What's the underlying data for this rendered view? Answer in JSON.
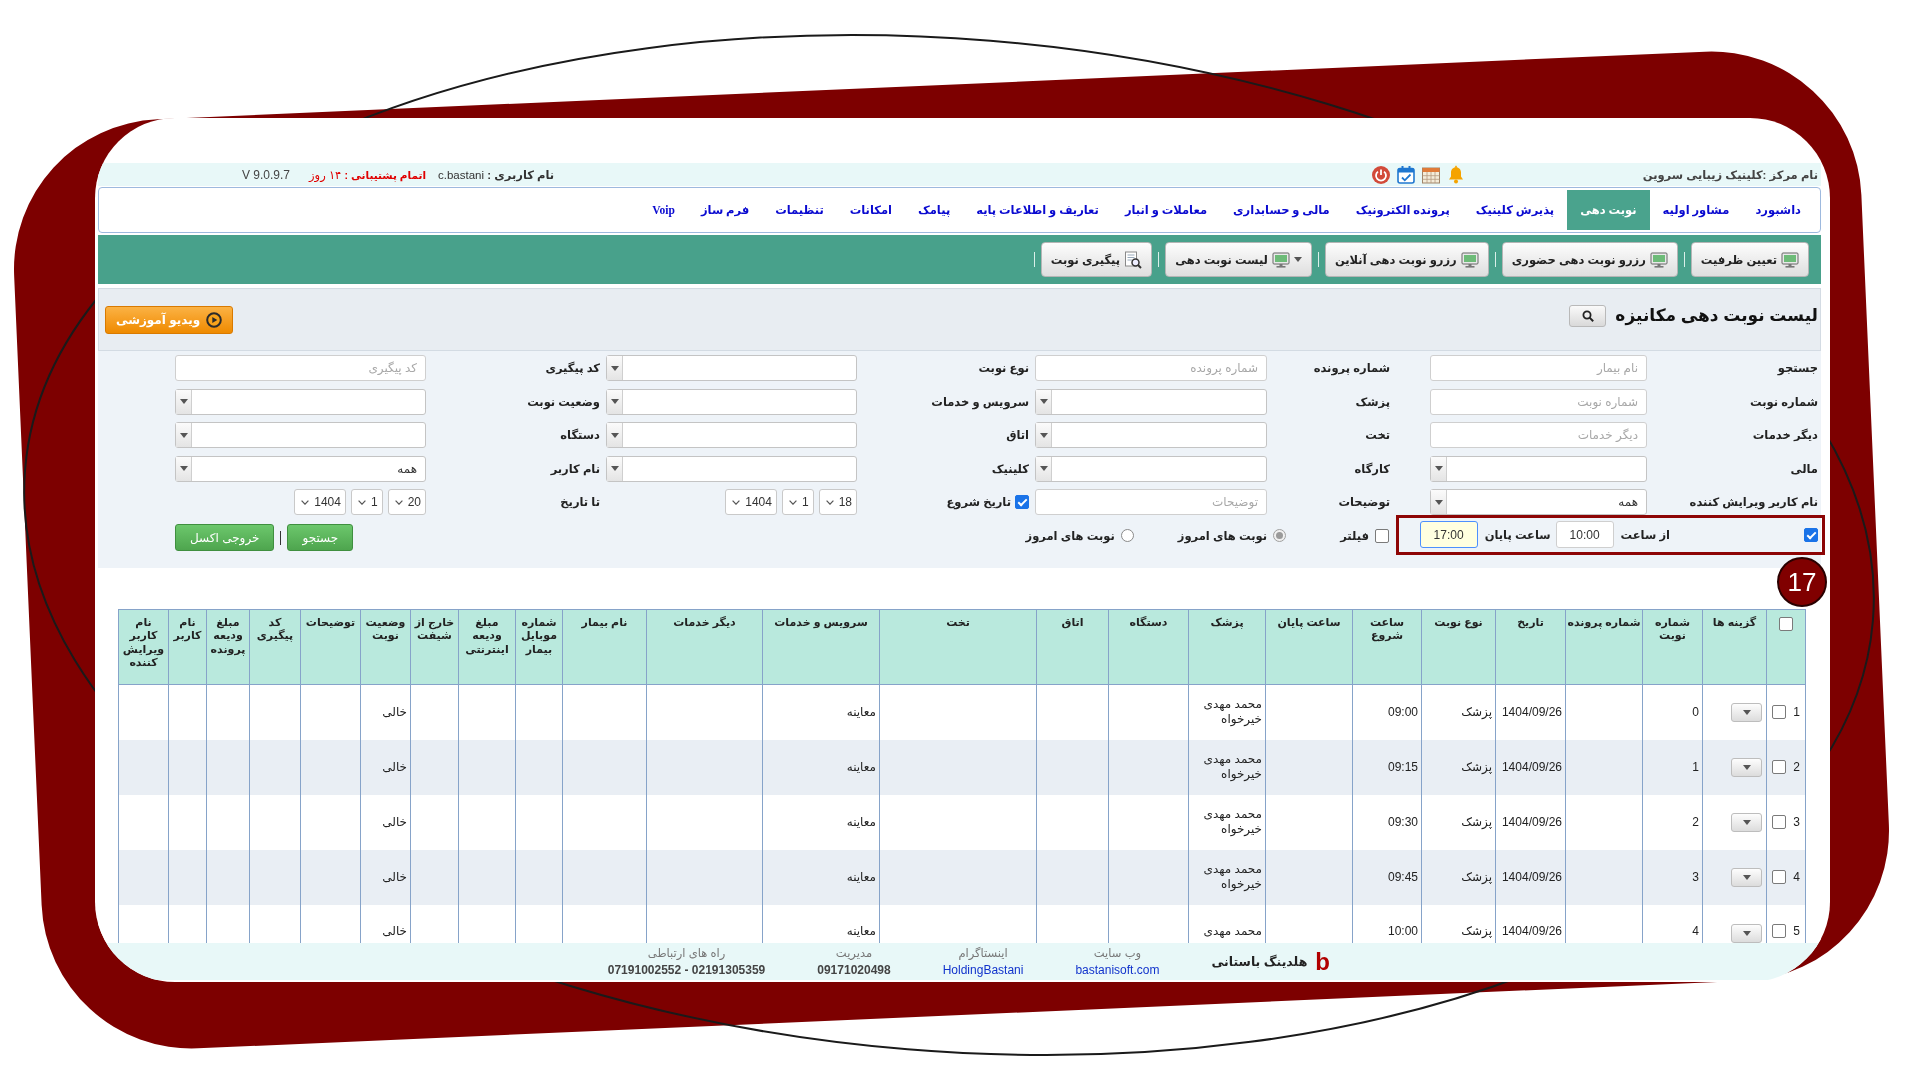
{
  "header": {
    "center_name": "نام مرکز :کلینیک زیبایی سروین",
    "user": "**نام کاربری :** c.bastani",
    "support": "**اتمام پشتیبانی :** ۱۴ روز",
    "version": "V 9.0.9.7"
  },
  "nav": [
    {
      "label": "داشبورد",
      "selected": false
    },
    {
      "label": "مشاور اولیه",
      "selected": false
    },
    {
      "label": "نوبت دهی",
      "selected": true
    },
    {
      "label": "پذیرش کلینیک",
      "selected": false
    },
    {
      "label": "پرونده الکترونیک",
      "selected": false
    },
    {
      "label": "مالی و حسابداری",
      "selected": false
    },
    {
      "label": "معاملات و انبار",
      "selected": false
    },
    {
      "label": "تعاریف و اطلاعات پایه",
      "selected": false
    },
    {
      "label": "پیامک",
      "selected": false
    },
    {
      "label": "امکانات",
      "selected": false
    },
    {
      "label": "تنظیمات",
      "selected": false
    },
    {
      "label": "فرم ساز",
      "selected": false
    },
    {
      "label": "Voip",
      "selected": false
    }
  ],
  "toolbar": [
    {
      "label": "تعیین ظرفیت",
      "kind": "action"
    },
    {
      "label": "رزرو نوبت دهی حضوری",
      "kind": "action"
    },
    {
      "label": "رزرو نوبت دهی آنلاین",
      "kind": "action"
    },
    {
      "label": "لیست نوبت دهی",
      "kind": "menu"
    },
    {
      "label": "پیگیری نوبت",
      "kind": "search"
    }
  ],
  "page": {
    "title": "لیست نوبت دهی مکانیزه",
    "video_button": "ویدیو آموزشی"
  },
  "filters": {
    "rows": [
      [
        {
          "label": "جستجو",
          "field": {
            "kind": "input",
            "placeholder": "نام بیمار"
          }
        },
        {
          "label": "شماره پرونده",
          "field": {
            "kind": "input",
            "placeholder": "شماره پرونده"
          }
        },
        {
          "label": "نوع نوبت",
          "field": {
            "kind": "select"
          }
        },
        {
          "label": "کد پیگیری",
          "field": {
            "kind": "input",
            "placeholder": "کد پیگیری"
          }
        }
      ],
      [
        {
          "label": "شماره نوبت",
          "field": {
            "kind": "input",
            "placeholder": "شماره نوبت"
          }
        },
        {
          "label": "پزشک",
          "field": {
            "kind": "select"
          }
        },
        {
          "label": "سرویس و خدمات",
          "field": {
            "kind": "select"
          }
        },
        {
          "label": "وضعیت نوبت",
          "field": {
            "kind": "select"
          }
        }
      ],
      [
        {
          "label": "دیگر خدمات",
          "field": {
            "kind": "input",
            "placeholder": "دیگر خدمات"
          }
        },
        {
          "label": "تخت",
          "field": {
            "kind": "select"
          }
        },
        {
          "label": "اتاق",
          "field": {
            "kind": "select"
          }
        },
        {
          "label": "دستگاه",
          "field": {
            "kind": "select"
          }
        }
      ],
      [
        {
          "label": "مالی",
          "field": {
            "kind": "select"
          }
        },
        {
          "label": "کارگاه",
          "field": {
            "kind": "select"
          }
        },
        {
          "label": "کلینیک",
          "field": {
            "kind": "select"
          }
        },
        {
          "label": "نام کاربر",
          "field": {
            "kind": "select",
            "value": "همه"
          }
        }
      ],
      [
        {
          "label": "نام کاربر ویرایش کننده",
          "field": {
            "kind": "select",
            "value": "همه"
          }
        },
        {
          "label": "توضیحات",
          "field": {
            "kind": "input",
            "placeholder": "توضیحات"
          }
        },
        {
          "label": "تاریخ شروع",
          "checked": true,
          "field": {
            "kind": "date",
            "day": "18",
            "month": "1",
            "year": "1404"
          }
        },
        {
          "label": "تا تاریخ",
          "field": {
            "kind": "date",
            "day": "20",
            "month": "1",
            "year": "1404"
          }
        }
      ]
    ],
    "time_filter": {
      "checked": true,
      "fields": [
        {
          "label": "از ساعت",
          "value": "10:00",
          "focused": false
        },
        {
          "label": "ساعت پایان",
          "value": "17:00",
          "focused": true
        }
      ]
    },
    "filter_option": {
      "label": "فیلتر",
      "checked": false
    },
    "day_options": [
      {
        "label": "نوبت های امروز",
        "selected": true
      },
      {
        "label": "نوبت های امروز",
        "selected": false
      }
    ],
    "actions": [
      "جستجو",
      "خروجی اکسل"
    ]
  },
  "table": {
    "select_all_checked": false,
    "columns": [
      "گزینه ها",
      "شماره نوبت",
      "شماره پرونده",
      "تاریخ",
      "نوع نوبت",
      "ساعت شروع",
      "ساعت پایان",
      "پزشک",
      "دستگاه",
      "اتاق",
      "تخت",
      "سرویس و خدمات",
      "دیگر خدمات",
      "نام بیمار",
      "شماره موبایل بیمار",
      "مبلغ ودیعه اینترنتی",
      "خارج از شیفت",
      "وضعیت نوبت",
      "توضیحات",
      "کد پیگیری",
      "مبلغ ودیعه پرونده",
      "نام کاربر",
      "نام کاربر ویرایش کننده"
    ],
    "rows": [
      {
        "number": "1",
        "checked": false,
        "appointment_number": "0",
        "date": "1404/09/26",
        "type": "پزشک",
        "start_time": "09:00",
        "doctor": "محمد مهدی خیرخواه",
        "service": "معاینه",
        "status": "خالی"
      },
      {
        "number": "2",
        "checked": false,
        "appointment_number": "1",
        "date": "1404/09/26",
        "type": "پزشک",
        "start_time": "09:15",
        "doctor": "محمد مهدی خیرخواه",
        "service": "معاینه",
        "status": "خالی"
      },
      {
        "number": "3",
        "checked": false,
        "appointment_number": "2",
        "date": "1404/09/26",
        "type": "پزشک",
        "start_time": "09:30",
        "doctor": "محمد مهدی خیرخواه",
        "service": "معاینه",
        "status": "خالی"
      },
      {
        "number": "4",
        "checked": false,
        "appointment_number": "3",
        "date": "1404/09/26",
        "type": "پزشک",
        "start_time": "09:45",
        "doctor": "محمد مهدی خیرخواه",
        "service": "معاینه",
        "status": "خالی"
      },
      {
        "number": "5",
        "checked": false,
        "appointment_number": "4",
        "date": "1404/09/26",
        "type": "پزشک",
        "start_time": "10:00",
        "doctor": "محمد مهدی",
        "service": "معاینه",
        "status": "خالی"
      }
    ]
  },
  "footer": {
    "logo": "b",
    "brand": "هلدینگ باستانی",
    "contacts": [
      {
        "label": "وب سایت",
        "value": "bastanisoft.com",
        "kind": "link"
      },
      {
        "label": "اینستاگرام",
        "value": "HoldingBastani",
        "kind": "link"
      },
      {
        "label": "مدیریت",
        "value": "09171020498",
        "kind": "phone"
      },
      {
        "label": "راه های ارتباطی",
        "value": "07191002552 - 02191305359",
        "kind": "phone"
      }
    ]
  },
  "step_badge": "17"
}
